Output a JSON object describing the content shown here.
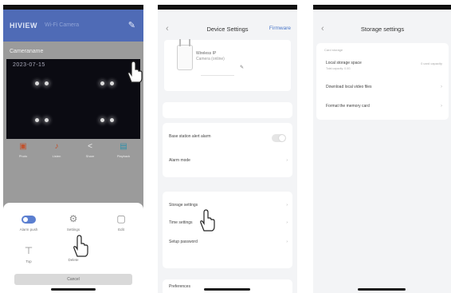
{
  "phone1": {
    "brand": "HIVIEW",
    "subtitle": "Wi-Fi Camera",
    "camera_title": "Cameraname",
    "timestamp": "2023-07-15",
    "tools": [
      {
        "label": "Photo"
      },
      {
        "label": "Listen"
      },
      {
        "label": "Share"
      },
      {
        "label": "Playback"
      }
    ],
    "sheet_options": [
      {
        "label": "Alarm push"
      },
      {
        "label": "Settings"
      },
      {
        "label": "Edit"
      },
      {
        "label": "Top"
      },
      {
        "label": "Delete"
      }
    ],
    "cancel_label": "Cancel"
  },
  "phone2": {
    "title": "Device Settings",
    "action": "Firmware",
    "device_name": "Wireless IP",
    "device_status": "Camera (online)",
    "section_items": [
      {
        "label": "Base station alert alarm"
      },
      {
        "label": "Alarm mode"
      },
      {
        "label": "Storage settings"
      },
      {
        "label": "Time settings"
      },
      {
        "label": "Setup password"
      },
      {
        "label": "Preferences"
      }
    ]
  },
  "phone3": {
    "title": "Storage settings",
    "group_caption": "Card storage",
    "items": [
      {
        "label": "Local storage space",
        "sub": "Total capacity: 0.0G",
        "value": "0 card capacity"
      },
      {
        "label": "Download local video files"
      },
      {
        "label": "Format the memory card"
      }
    ]
  },
  "colors": {
    "accent": "#4f6bb6",
    "link": "#4a77c9"
  }
}
